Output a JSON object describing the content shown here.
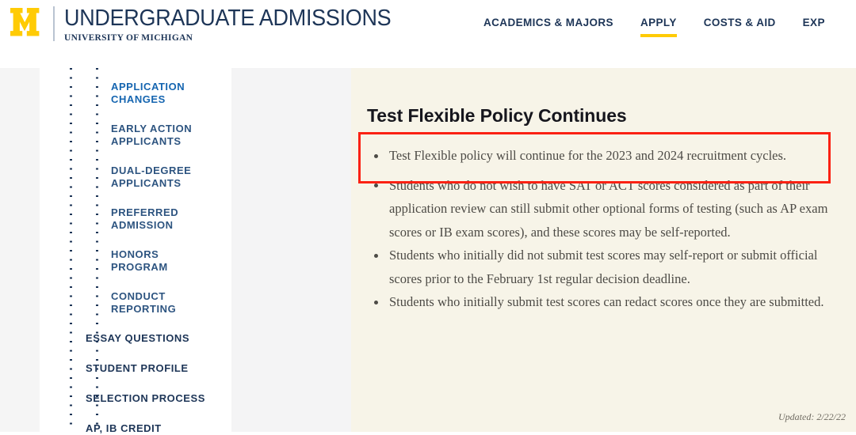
{
  "header": {
    "logo_icon": "block-m-logo",
    "brand_title": "UNDERGRADUATE ADMISSIONS",
    "brand_subtitle": "UNIVERSITY OF MICHIGAN",
    "nav_items": [
      {
        "label": "ACADEMICS & MAJORS",
        "active": false
      },
      {
        "label": "APPLY",
        "active": true
      },
      {
        "label": "COSTS & AID",
        "active": false
      },
      {
        "label": "EXP",
        "active": false
      }
    ],
    "accent_color": "#ffcb05",
    "navy_color": "#1d3557"
  },
  "sidebar": {
    "items": [
      {
        "label": "APPLICATION\nCHANGES",
        "level": 2,
        "active": true
      },
      {
        "label": "EARLY ACTION\nAPPLICANTS",
        "level": 2,
        "active": false
      },
      {
        "label": "DUAL-DEGREE\nAPPLICANTS",
        "level": 2,
        "active": false
      },
      {
        "label": "PREFERRED\nADMISSION",
        "level": 2,
        "active": false
      },
      {
        "label": "HONORS\nPROGRAM",
        "level": 2,
        "active": false
      },
      {
        "label": "CONDUCT\nREPORTING",
        "level": 2,
        "active": false
      },
      {
        "label": "ESSAY QUESTIONS",
        "level": 1,
        "active": false
      },
      {
        "label": "STUDENT PROFILE",
        "level": 1,
        "active": false
      },
      {
        "label": "SELECTION PROCESS",
        "level": 1,
        "active": false
      },
      {
        "label": "AP, IB CREDIT",
        "level": 1,
        "active": false
      }
    ]
  },
  "content": {
    "title": "Test Flexible Policy Continues",
    "bullets": [
      "Test Flexible policy will continue for the 2023 and 2024 recruitment cycles.",
      "Students who do not wish to have SAT or ACT scores considered as part of their application review can still submit other optional forms of testing (such as AP exam scores or IB exam scores), and these scores may be self-reported.",
      "Students who initially did not submit test scores may self-report or submit official scores prior to the February 1st regular decision deadline.",
      "Students who initially submit test scores can redact scores once they are submitted."
    ],
    "updated_note": "Updated: 2/22/22",
    "card_background": "#f7f4e8"
  },
  "annotation": {
    "color": "#fb2113",
    "target": "first-bullet"
  }
}
